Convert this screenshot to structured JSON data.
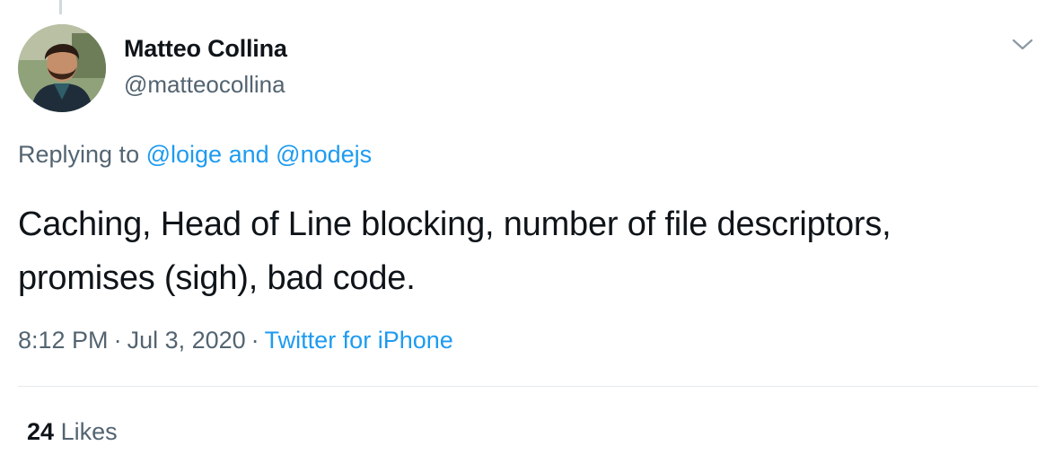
{
  "author": {
    "name": "Matteo Collina",
    "handle": "@matteocollina",
    "avatar_icon": "user-avatar-photo"
  },
  "reply": {
    "prefix": "Replying to",
    "mention1": "@loige",
    "conjunction": "and",
    "mention2": "@nodejs"
  },
  "tweet": {
    "text": "Caching, Head of Line blocking, number of file descriptors, promises (sigh), bad code."
  },
  "meta": {
    "time": "8:12 PM",
    "separator": "·",
    "date": "Jul 3, 2020",
    "source": "Twitter for iPhone"
  },
  "stats": {
    "likes_count": "24",
    "likes_label": "Likes"
  },
  "colors": {
    "link": "#1d9bf0",
    "secondary_text": "#536471",
    "primary_text": "#0f1419",
    "divider": "#e4e9ec"
  },
  "icons": {
    "more": "chevron-down-icon"
  }
}
